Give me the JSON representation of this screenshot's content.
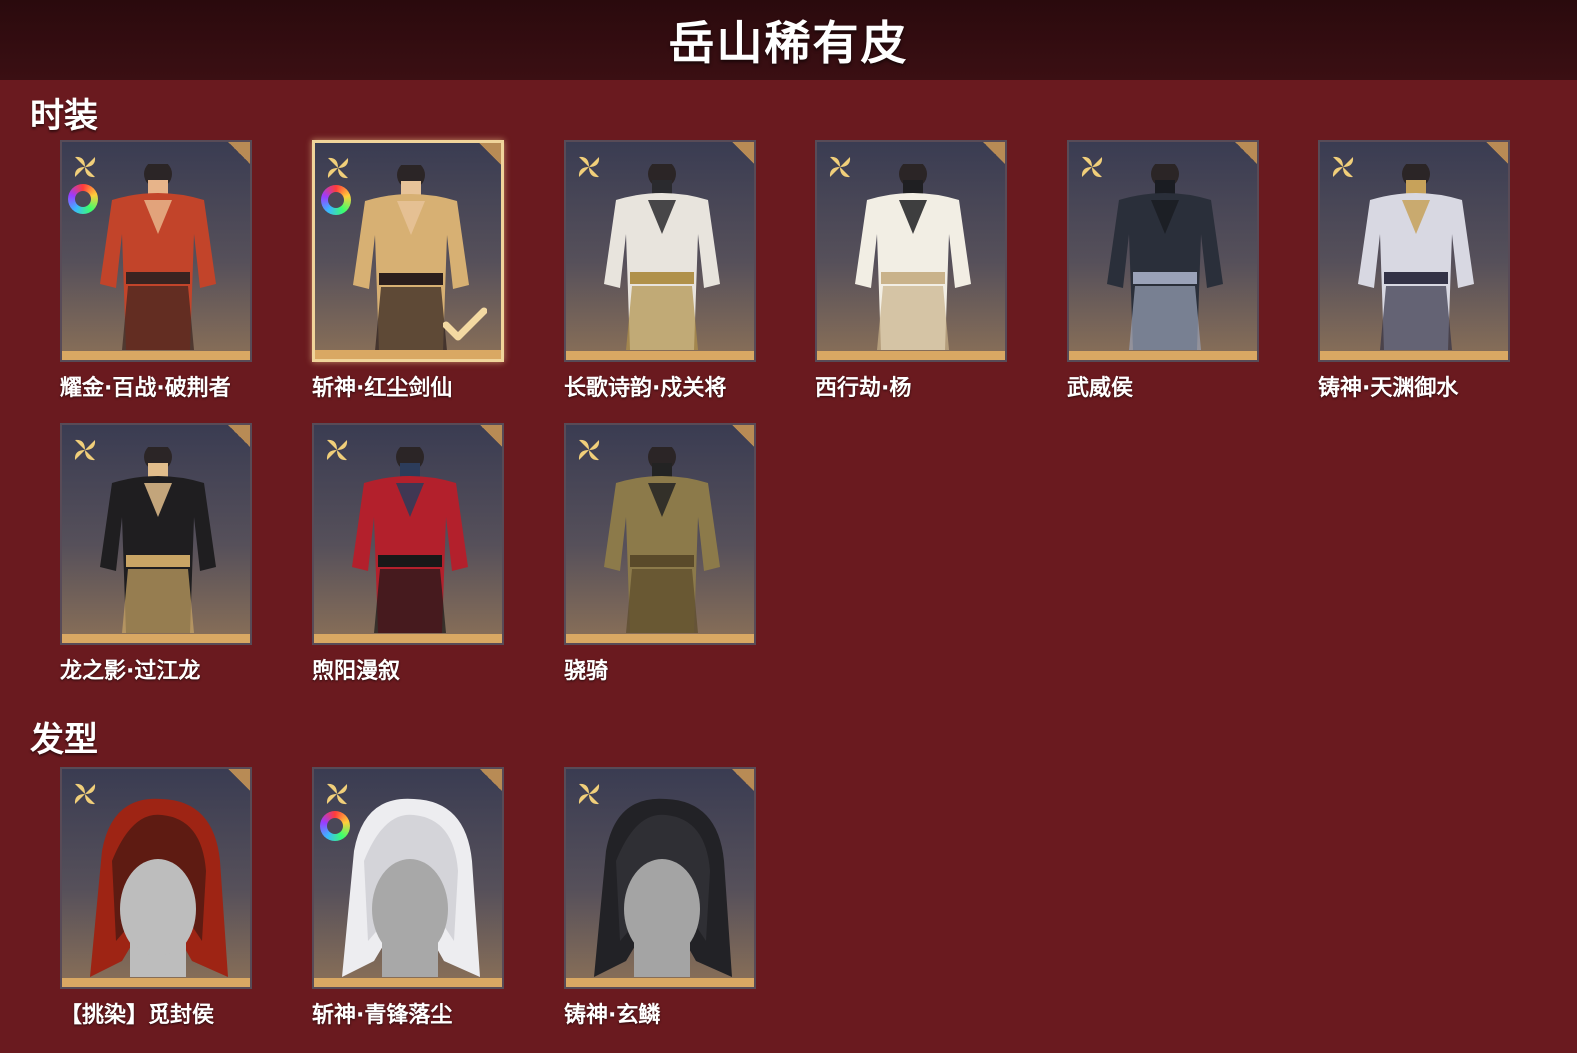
{
  "header": {
    "title": "岳山稀有皮"
  },
  "sections": {
    "fashion": {
      "title": "时装",
      "items": [
        {
          "name": "耀金·百战·破荆者",
          "dye": true,
          "selected": false,
          "palette": [
            "#c2442a",
            "#e7b48a",
            "#3a2320"
          ]
        },
        {
          "name": "斩神·红尘剑仙",
          "dye": true,
          "selected": true,
          "palette": [
            "#d7b073",
            "#e7c399",
            "#2b1e1c"
          ]
        },
        {
          "name": "长歌诗韵·戍关将",
          "dye": false,
          "selected": false,
          "palette": [
            "#e8e4dd",
            "#2a2a2e",
            "#b0914a"
          ]
        },
        {
          "name": "西行劫·杨",
          "dye": false,
          "selected": false,
          "palette": [
            "#f2eee4",
            "#1f1f22",
            "#c9b28a"
          ]
        },
        {
          "name": "武威侯",
          "dye": false,
          "selected": false,
          "palette": [
            "#2a2f3a",
            "#1a1c22",
            "#9aa2b8"
          ]
        },
        {
          "name": "铸神·天渊御水",
          "dye": false,
          "selected": false,
          "palette": [
            "#d8d8e2",
            "#c7a25a",
            "#333246"
          ]
        },
        {
          "name": "龙之影·过江龙",
          "dye": false,
          "selected": false,
          "palette": [
            "#1f1e20",
            "#e1bd8c",
            "#c9a565"
          ]
        },
        {
          "name": "煦阳漫叙",
          "dye": false,
          "selected": false,
          "palette": [
            "#b3202c",
            "#2c3c5a",
            "#181818"
          ]
        },
        {
          "name": "骁骑",
          "dye": false,
          "selected": false,
          "palette": [
            "#8c7a4a",
            "#232323",
            "#5a4a2a"
          ]
        }
      ]
    },
    "hair": {
      "title": "发型",
      "items": [
        {
          "name": "【挑染】觅封侯",
          "dye": false,
          "selected": false,
          "palette": [
            "#9e2414",
            "#2a1410",
            "#bdbdbd"
          ]
        },
        {
          "name": "斩神·青锋落尘",
          "dye": true,
          "selected": false,
          "palette": [
            "#ededf0",
            "#bfbfc6",
            "#a8a8a8"
          ]
        },
        {
          "name": "铸神·玄鳞",
          "dye": false,
          "selected": false,
          "palette": [
            "#222226",
            "#3a3a40",
            "#a4a4a4"
          ]
        }
      ]
    }
  },
  "colors": {
    "background": "#6a1a1f",
    "header": "#2a0a0d",
    "card_bar": "#d9a863",
    "selected_border": "#f0d49a",
    "rarity_icon": "#f1cf7a"
  },
  "icons": {
    "rarity": "gold-four-petal-icon",
    "dye": "color-wheel-icon",
    "selected": "check-icon"
  }
}
